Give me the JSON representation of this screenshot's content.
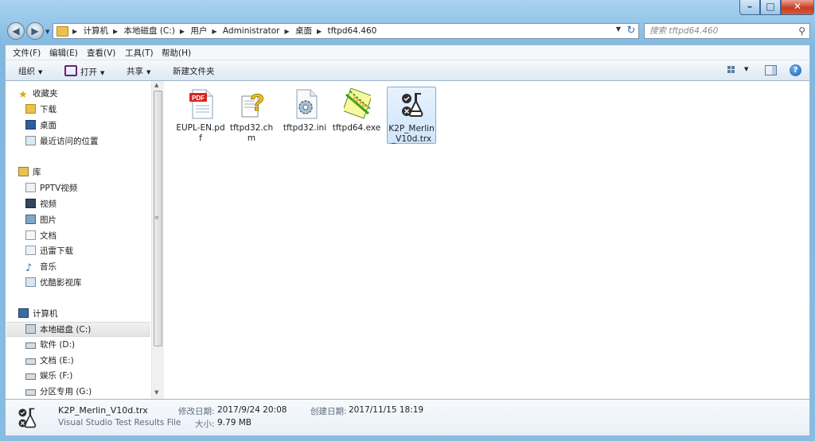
{
  "window": {
    "controls": {
      "minimize": "–",
      "maximize": "□",
      "close": "✕"
    }
  },
  "address": {
    "breadcrumbs": [
      "计算机",
      "本地磁盘 (C:)",
      "用户",
      "Administrator",
      "桌面",
      "tftpd64.460"
    ]
  },
  "search": {
    "placeholder": "搜索 tftpd64.460"
  },
  "menu": [
    "文件(F)",
    "编辑(E)",
    "查看(V)",
    "工具(T)",
    "帮助(H)"
  ],
  "toolbar": {
    "organize": "组织",
    "open": "打开",
    "share": "共享",
    "new_folder": "新建文件夹"
  },
  "sidebar": {
    "favorites": {
      "label": "收藏夹",
      "items": [
        "下载",
        "桌面",
        "最近访问的位置"
      ]
    },
    "libraries": {
      "label": "库",
      "items": [
        "PPTV视频",
        "视频",
        "图片",
        "文档",
        "迅雷下载",
        "音乐",
        "优酷影视库"
      ]
    },
    "computer": {
      "label": "计算机",
      "items": [
        "本地磁盘 (C:)",
        "软件 (D:)",
        "文档 (E:)",
        "娱乐 (F:)",
        "分区专用 (G:)"
      ]
    }
  },
  "files": [
    {
      "name": "EUPL-EN.pdf",
      "icon": "pdf-file-icon"
    },
    {
      "name": "tftpd32.chm",
      "icon": "help-file-icon"
    },
    {
      "name": "tftpd32.ini",
      "icon": "config-file-icon"
    },
    {
      "name": "tftpd64.exe",
      "icon": "tftp-exe-icon"
    },
    {
      "name": "K2P_Merlin_V10d.trx",
      "icon": "test-results-icon",
      "selected": true
    }
  ],
  "status": {
    "name": "K2P_Merlin_V10d.trx",
    "type": "Visual Studio Test Results File",
    "modified_label": "修改日期:",
    "modified": "2017/9/24 20:08",
    "created_label": "创建日期:",
    "created": "2017/11/15 18:19",
    "size_label": "大小:",
    "size": "9.79 MB"
  },
  "colors": {
    "selection": "#cfe5fb",
    "window_frame": "#7fb8e0",
    "close_button": "#c73b22"
  }
}
